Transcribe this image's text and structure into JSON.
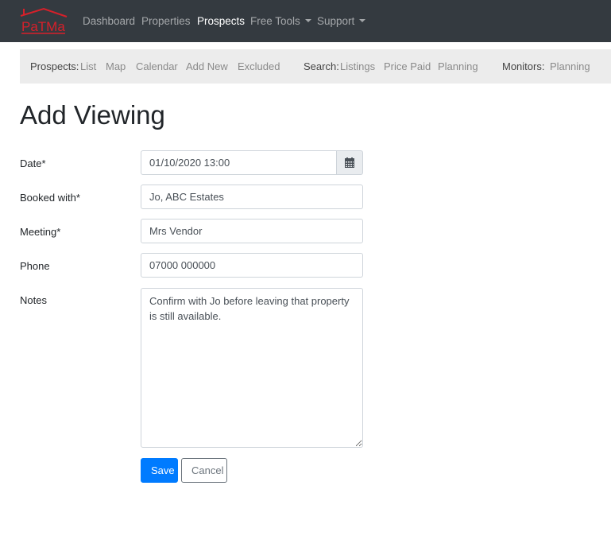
{
  "navbar": {
    "logo_text": "PaTMa",
    "brand_color": "#d6202a",
    "items": [
      {
        "label": "Dashboard",
        "active": false
      },
      {
        "label": "Properties",
        "active": false
      },
      {
        "label": "Prospects",
        "active": true
      },
      {
        "label": "Free Tools",
        "dropdown": true
      },
      {
        "label": "Support",
        "dropdown": true
      }
    ]
  },
  "subnav": {
    "prospects_label": "Prospects:",
    "prospects_links": [
      "List",
      "Map",
      "Calendar",
      "Add New",
      "Excluded"
    ],
    "search_label": "Search:",
    "search_links": [
      "Listings",
      "Price Paid",
      "Planning"
    ],
    "monitors_label": "Monitors:",
    "monitors_links": [
      "Planning"
    ]
  },
  "page": {
    "title": "Add Viewing"
  },
  "form": {
    "date": {
      "label": "Date*",
      "value": "01/10/2020 13:00",
      "icon": "calendar-icon"
    },
    "booked_with": {
      "label": "Booked with*",
      "value": "Jo, ABC Estates"
    },
    "meeting": {
      "label": "Meeting*",
      "value": "Mrs Vendor"
    },
    "phone": {
      "label": "Phone",
      "value": "07000 000000"
    },
    "notes": {
      "label": "Notes",
      "value": "Confirm with Jo before leaving that property is still available."
    },
    "save_label": "Save",
    "cancel_label": "Cancel",
    "primary_color": "#007bff"
  }
}
